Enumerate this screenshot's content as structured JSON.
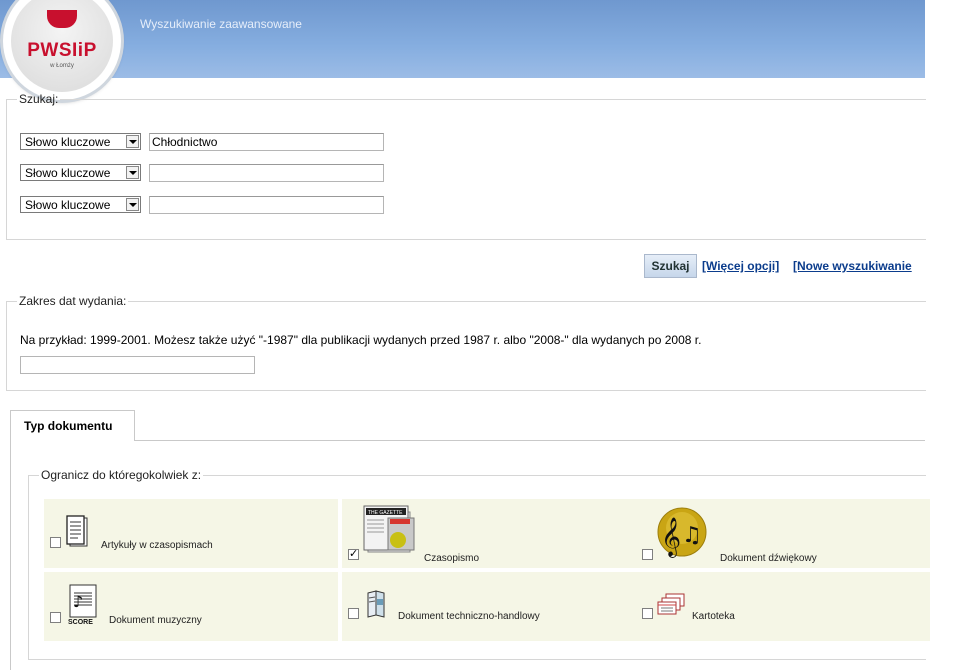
{
  "header": {
    "title": "Wyszukiwanie zaawansowane",
    "logo_text": "PWSIiP",
    "logo_sub": "w Łomży"
  },
  "search": {
    "legend": "Szukaj:",
    "rows": [
      {
        "field": "Słowo kluczowe",
        "value": "Chłodnictwo"
      },
      {
        "field": "Słowo kluczowe",
        "value": ""
      },
      {
        "field": "Słowo kluczowe",
        "value": ""
      }
    ],
    "button": "Szukaj",
    "more_options": "[Więcej opcji]",
    "new_search": "[Nowe wyszukiwanie"
  },
  "dates": {
    "legend": "Zakres dat wydania:",
    "note": "Na przykład: 1999-2001. Możesz także użyć \"-1987\" dla publikacji wydanych przed 1987 r. albo \"2008-\" dla wydanych po 2008 r.",
    "value": ""
  },
  "doctype": {
    "tab": "Typ dokumentu",
    "legend": "Ogranicz do któregokolwiek z:",
    "items": [
      {
        "label": "Artykuły w czasopismach",
        "checked": false,
        "icon": "document-icon"
      },
      {
        "label": "Czasopismo",
        "checked": true,
        "icon": "newspaper-icon"
      },
      {
        "label": "Dokument dźwiękowy",
        "checked": false,
        "icon": "music-note-icon"
      },
      {
        "label": "Dokument muzyczny",
        "checked": false,
        "icon": "score-icon"
      },
      {
        "label": "Dokument techniczno-handlowy",
        "checked": false,
        "icon": "brochure-icon"
      },
      {
        "label": "Kartoteka",
        "checked": false,
        "icon": "card-file-icon"
      }
    ]
  }
}
